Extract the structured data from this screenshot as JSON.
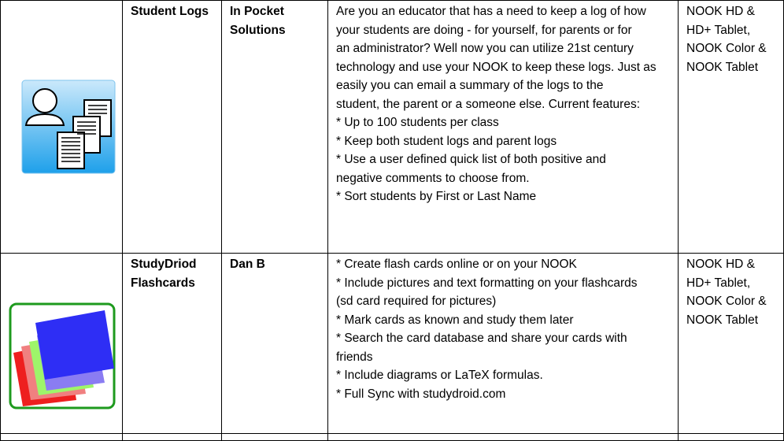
{
  "rows": [
    {
      "name_lines": [
        "Student Logs"
      ],
      "developer_lines": [
        "In Pocket",
        "Solutions"
      ],
      "icon": "student-logs-icon",
      "description_lines": [
        "Are you an educator that has a need to keep a log of how",
        "your students are doing - for yourself, for parents or for",
        "an administrator? Well now you can utilize 21st century",
        "technology and use your NOOK to keep these logs. Just as",
        "easily you can email a summary of the logs to the",
        "student, the parent or a someone else. Current features:",
        "* Up to 100 students per class",
        "* Keep both student logs and parent logs",
        "* Use a user defined quick list of both positive and",
        "negative comments to choose from.",
        "* Sort students by First or Last Name"
      ],
      "devices_lines": [
        "NOOK HD &",
        "HD+ Tablet,",
        "NOOK Color &",
        "NOOK Tablet"
      ]
    },
    {
      "name_lines": [
        "StudyDriod",
        "Flashcards"
      ],
      "developer_lines": [
        "Dan B"
      ],
      "icon": "flashcards-icon",
      "description_lines": [
        "* Create flash cards online or on your NOOK",
        "* Include pictures and text formatting on your flashcards",
        "(sd card required for pictures)",
        "* Mark cards as known and study them later",
        "* Search the card database and share your cards with",
        "friends",
        "* Include diagrams or LaTeX formulas.",
        "* Full Sync with studydroid.com"
      ],
      "devices_lines": [
        "NOOK HD &",
        "HD+ Tablet,",
        "NOOK Color &",
        "NOOK Tablet"
      ]
    }
  ],
  "colors": {
    "student_logs_icon_top": "#cbe9fb",
    "student_logs_icon_bottom": "#1ea0ea",
    "flashcards_border": "#1e9a1e",
    "card_blue": "#2e2ef5",
    "card_lilac": "#8a7cf2",
    "card_green": "#9ef56a",
    "card_salmon": "#f08080",
    "card_red": "#ee1f1f"
  }
}
